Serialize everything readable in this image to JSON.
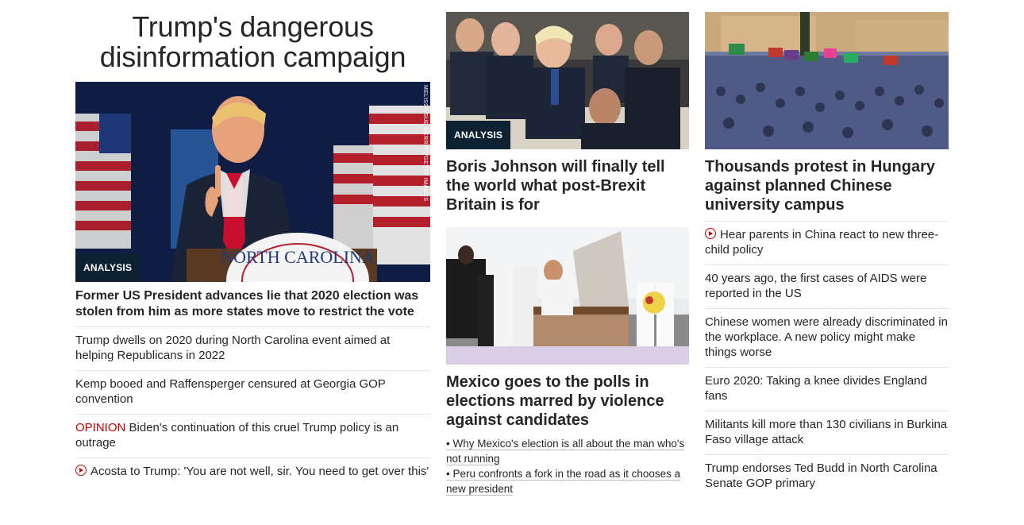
{
  "col1": {
    "hero_title": "Trump's dangerous disinformation campaign",
    "image_badge": "ANALYSIS",
    "image_credit": "MELISSA SUE GERRITS/GETTY IMAGES",
    "podium_text": "NORTH CAROLINA",
    "headline": "Former US President advances lie that 2020 election was stolen from him as more states move to restrict the vote",
    "links": [
      "Trump dwells on 2020 during North Carolina event aimed at helping Republicans in 2022",
      "Kemp booed and Raffensperger censured at Georgia GOP convention"
    ],
    "opinion_label": "OPINION",
    "opinion_text": " Biden's continuation of this cruel Trump policy is an outrage",
    "video_text": "Acosta to Trump: 'You are not well, sir. You need to get over this'"
  },
  "col2": {
    "story1_badge": "ANALYSIS",
    "story1_headline": "Boris Johnson will finally tell the world what post-Brexit Britain is for",
    "story2_headline": "Mexico goes to the polls in elections marred by violence against candidates",
    "bullets": [
      "• Why Mexico's election is all about the man who's not running",
      "• Peru confronts a fork in the road as it chooses a new president"
    ]
  },
  "col3": {
    "headline": "Thousands protest in Hungary against planned Chinese university campus",
    "video_text": "Hear parents in China react to new three-child policy",
    "links": [
      "40 years ago, the first cases of AIDS were reported in the US",
      "Chinese women were already discriminated in the workplace. A new policy might make things worse",
      "Euro 2020: Taking a knee divides England fans",
      "Militants kill more than 130 civilians in Burkina Faso village attack",
      "Trump endorses Ted Budd in North Carolina Senate GOP primary"
    ]
  },
  "colors": {
    "badge_bg": "#0c2233",
    "opinion": "#cc0000",
    "text": "#262626"
  },
  "icons": {
    "video": "play-circle-icon"
  }
}
